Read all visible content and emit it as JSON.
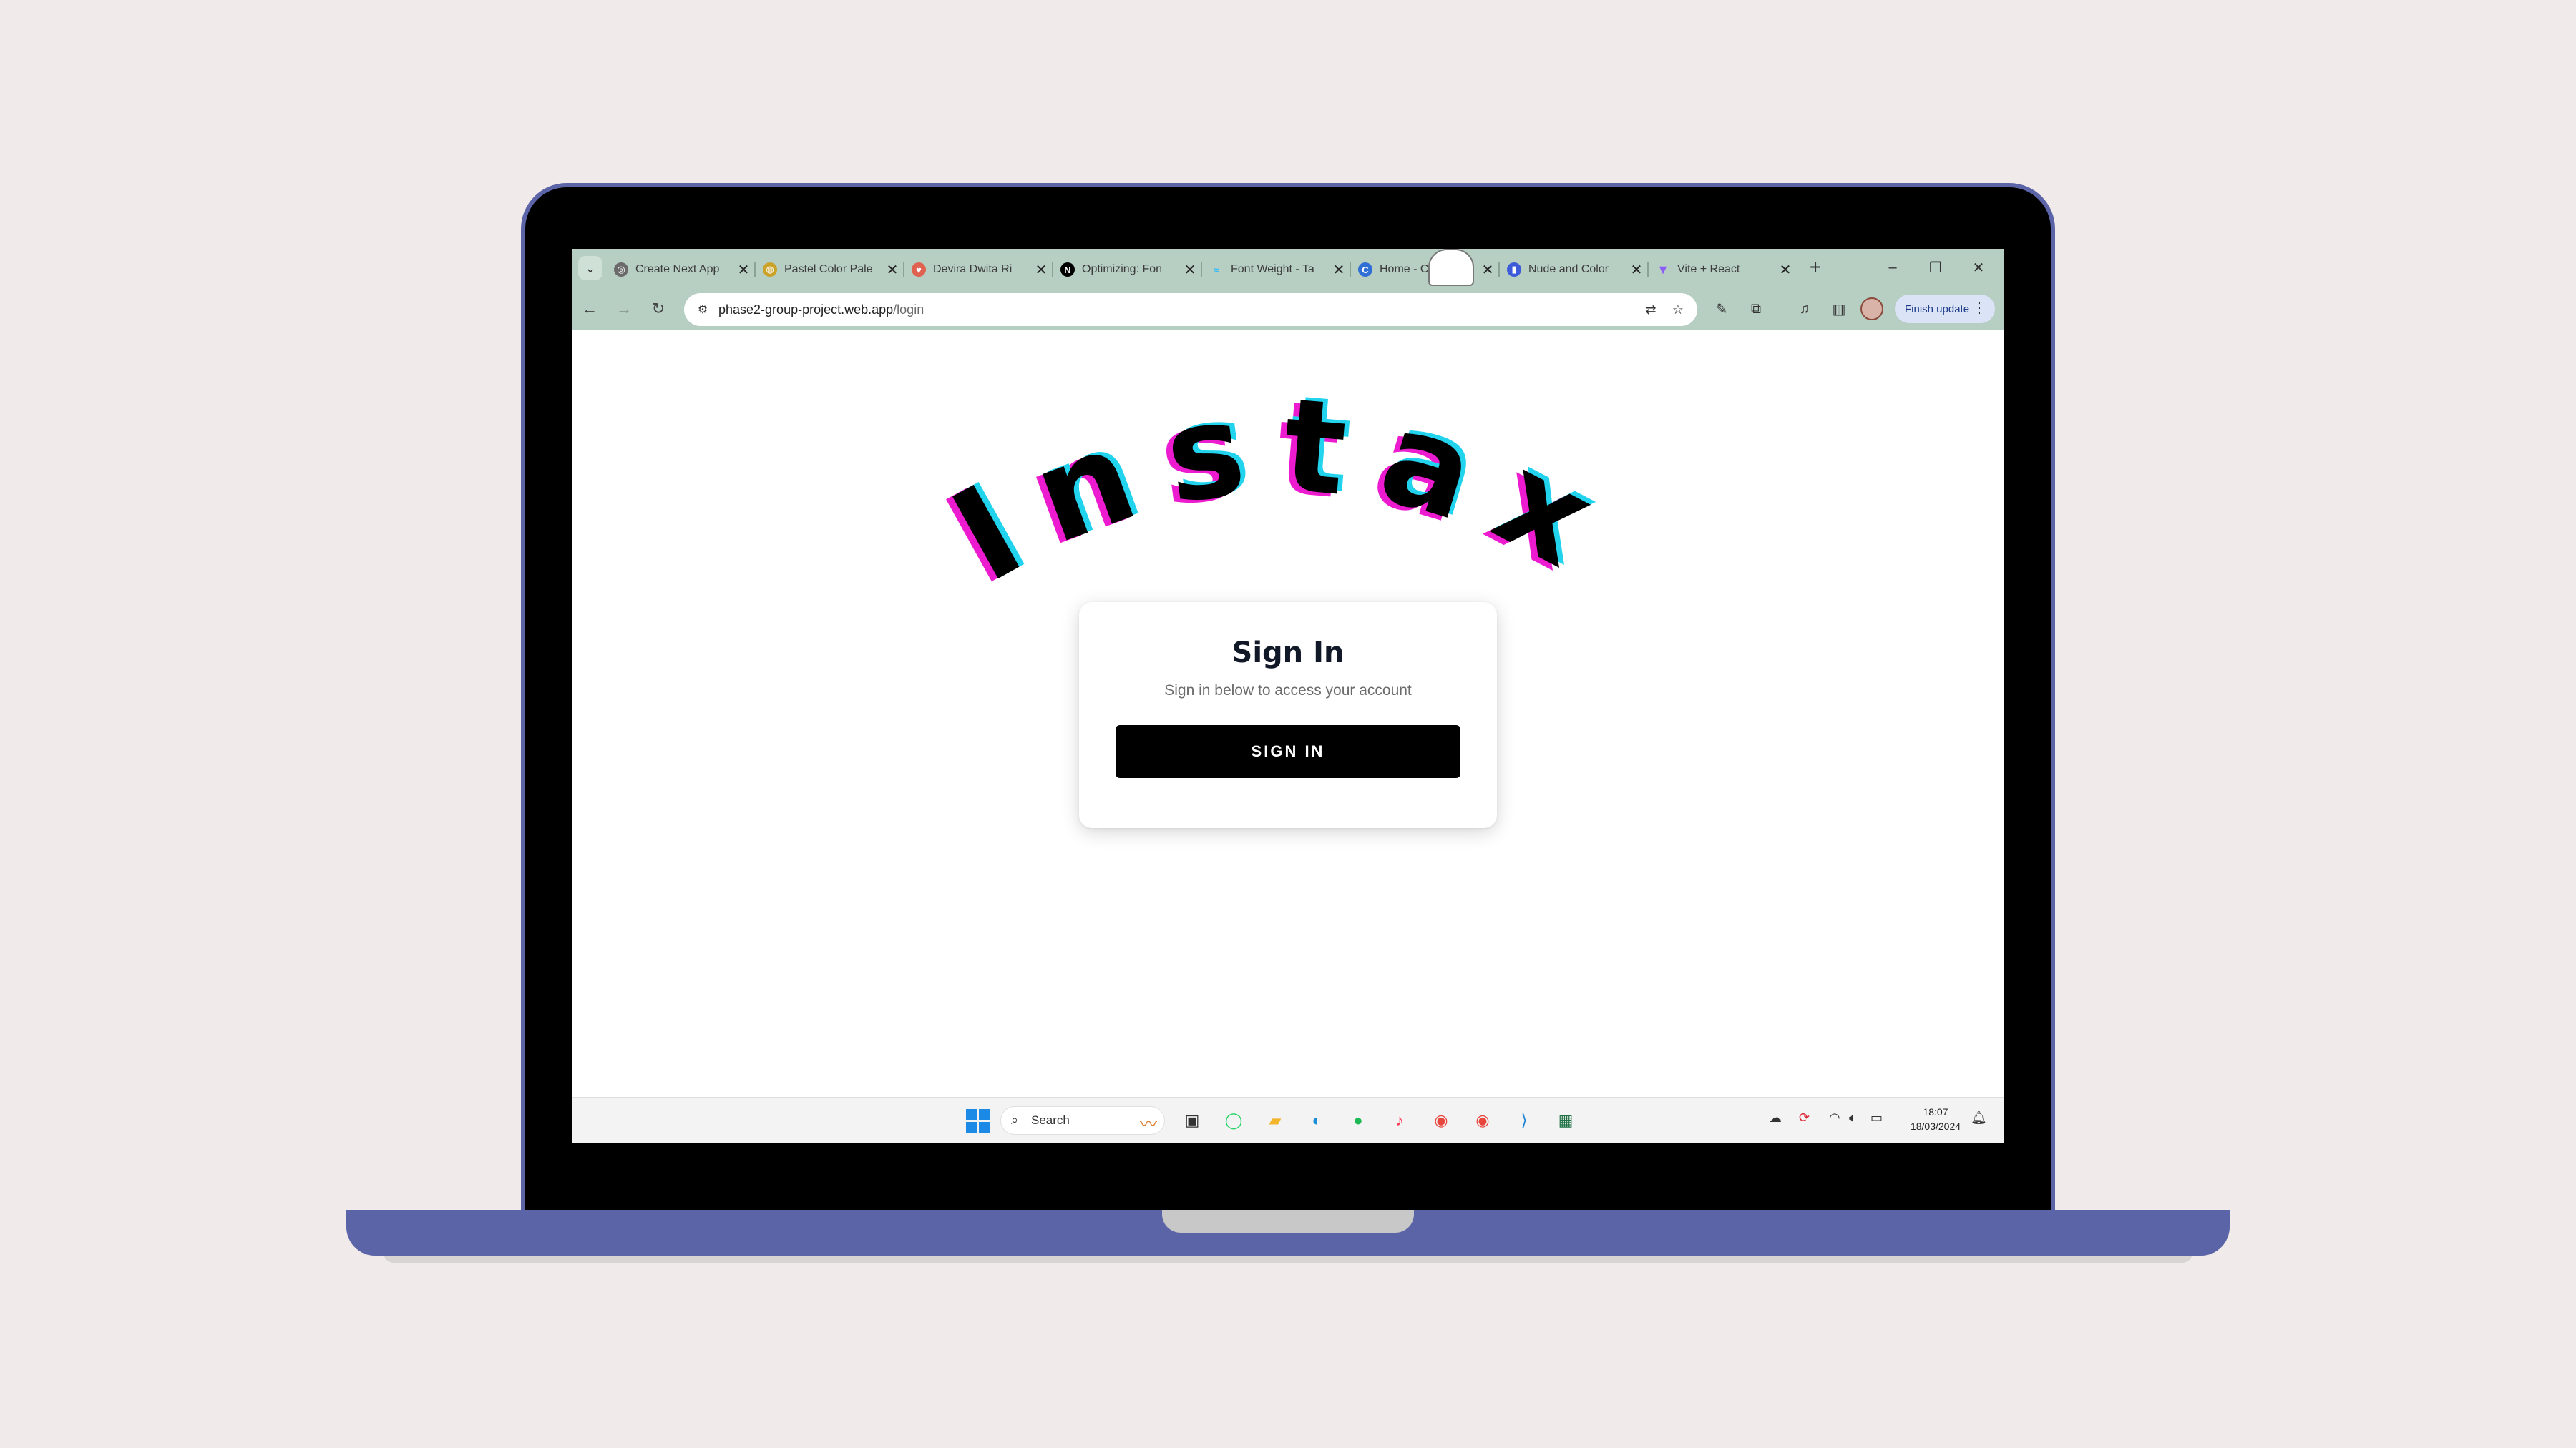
{
  "browser": {
    "tabs": [
      {
        "label": "Create Next App",
        "icon": "globe-icon",
        "color": "#555555"
      },
      {
        "label": "Pastel Color Pale",
        "icon": "palette-icon",
        "color": "#c9a227"
      },
      {
        "label": "Devira Dwita Ri",
        "icon": "heart-icon",
        "color": "#e0614f"
      },
      {
        "label": "Optimizing: Fon",
        "icon": "nextjs-icon",
        "color": "#000000"
      },
      {
        "label": "Font Weight - Ta",
        "icon": "tailwind-icon",
        "color": "#38bdf8"
      },
      {
        "label": "Home - Canva",
        "icon": "canva-icon",
        "color": "#2f6fd6"
      },
      {
        "label": "Nude and Color",
        "icon": "bookmark-icon",
        "color": "#3d5bd9"
      },
      {
        "label": "Vite + React",
        "icon": "vite-icon",
        "color": "#8b5cf6"
      }
    ],
    "new_tab": "+",
    "url_host": "phase2-group-project.web.app",
    "url_path": "/login",
    "finish_update": "Finish update"
  },
  "page": {
    "logo_text": "Instax",
    "card_title": "Sign In",
    "card_subtitle": "Sign in below to access your account",
    "signin_button": "SIGN IN"
  },
  "taskbar": {
    "search_placeholder": "Search",
    "time": "18:07",
    "date": "18/03/2024"
  },
  "colors": {
    "frame": "#5c64a8",
    "browser_chrome": "#b7cec3",
    "logo_cyan": "#22d3ee",
    "logo_magenta": "#ec1bd0"
  }
}
